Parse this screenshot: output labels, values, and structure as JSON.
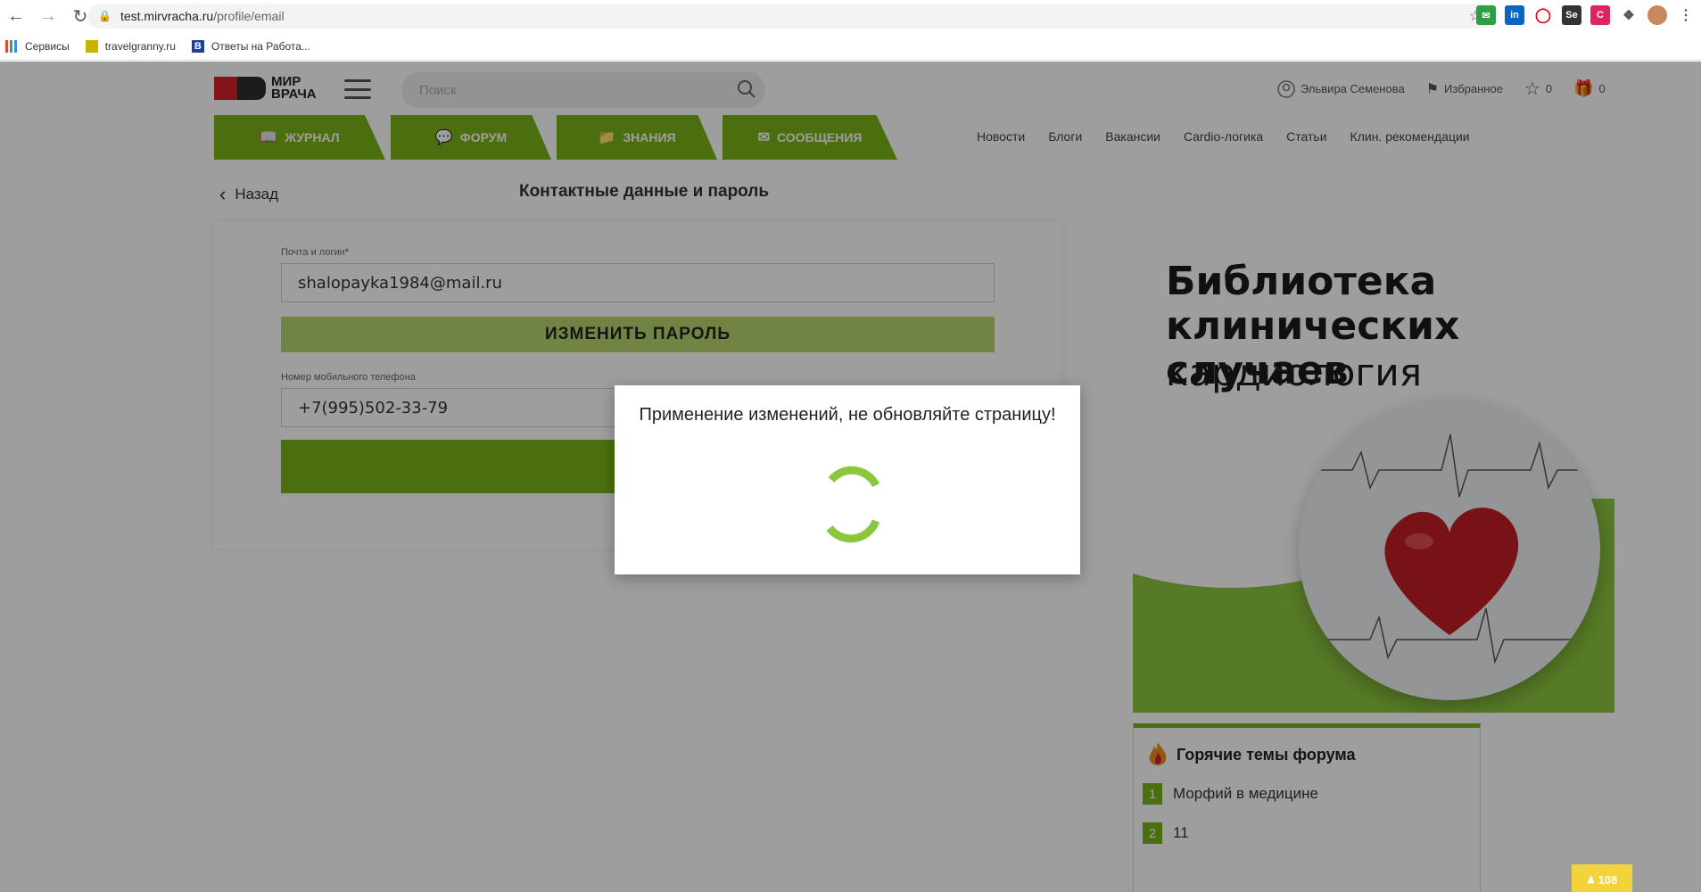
{
  "browser": {
    "url_host": "test.mirvracha.ru",
    "url_path": "/profile/email",
    "bookmarks": [
      "Сервисы",
      "travelgranny.ru",
      "Ответы на Работа..."
    ]
  },
  "header": {
    "logo_line1": "МИР",
    "logo_line2": "ВРАЧА",
    "search_placeholder": "Поиск",
    "user_name": "Эльвира Семенова",
    "favorites_label": "Избранное",
    "stars_count": "0",
    "gifts_count": "0",
    "tabs": [
      "ЖУРНАЛ",
      "ФОРУМ",
      "ЗНАНИЯ",
      "СООБЩЕНИЯ"
    ],
    "links": [
      "Новости",
      "Блоги",
      "Вакансии",
      "Cardio-логика",
      "Статьи",
      "Клин. рекомендации"
    ]
  },
  "page": {
    "back_label": "Назад",
    "title": "Контактные данные и пароль"
  },
  "form": {
    "email_label": "Почта и логин",
    "email_required_mark": "*",
    "email_value": "shalopayka1984@mail.ru",
    "change_password_label": "ИЗМЕНИТЬ ПАРОЛЬ",
    "phone_label": "Номер мобильного телефона",
    "phone_value": "+7(995)502-33-79",
    "save_label": "Co"
  },
  "banner": {
    "line1": "Библиотека",
    "line2": "клинических случаев",
    "line3": "кардиология"
  },
  "hot_topics": {
    "title": "Горячие темы форума",
    "items": [
      {
        "num": "1",
        "text": "Морфий в медицине"
      },
      {
        "num": "2",
        "text": "11"
      }
    ]
  },
  "counter": "108",
  "modal": {
    "message": "Применение изменений, не обновляйте страницу!"
  },
  "colors": {
    "brand_green": "#7ab317",
    "light_green": "#b6d66c",
    "spinner": "#8cc63f"
  }
}
